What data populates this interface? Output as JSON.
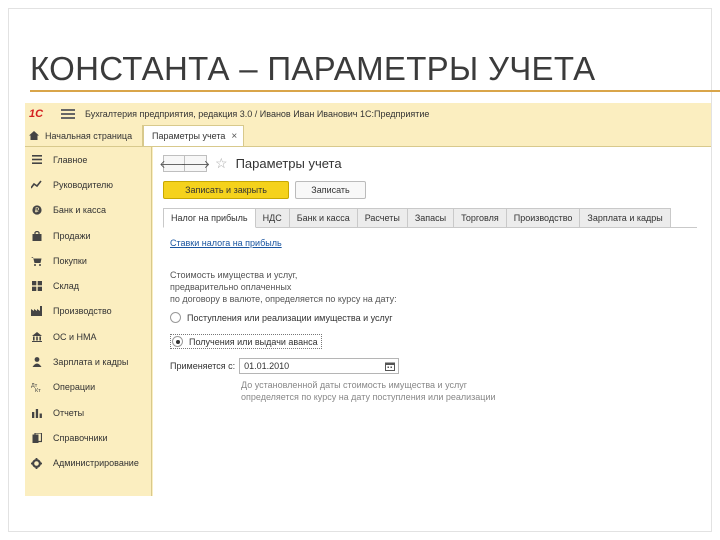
{
  "slide": {
    "title": "КОНСТАНТА – ПАРАМЕТРЫ УЧЕТА"
  },
  "app": {
    "logo": "1С",
    "title": "Бухгалтерия предприятия, редакция 3.0 / Иванов Иван Иванович 1С:Предприятие",
    "accent_color": "#f5d21c",
    "panel_color": "#fbeec0"
  },
  "tabs": {
    "home_label": "Начальная страница",
    "active_label": "Параметры учета",
    "close_glyph": "×"
  },
  "sidebar": {
    "items": [
      {
        "label": "Главное",
        "icon": "list-icon"
      },
      {
        "label": "Руководителю",
        "icon": "chart-icon"
      },
      {
        "label": "Банк и касса",
        "icon": "coin-icon"
      },
      {
        "label": "Продажи",
        "icon": "bag-icon"
      },
      {
        "label": "Покупки",
        "icon": "cart-icon"
      },
      {
        "label": "Склад",
        "icon": "grid-icon"
      },
      {
        "label": "Производство",
        "icon": "factory-icon"
      },
      {
        "label": "ОС и НМА",
        "icon": "building-icon"
      },
      {
        "label": "Зарплата и кадры",
        "icon": "people-icon"
      },
      {
        "label": "Операции",
        "icon": "operations-icon"
      },
      {
        "label": "Отчеты",
        "icon": "bar-chart-icon"
      },
      {
        "label": "Справочники",
        "icon": "book-icon"
      },
      {
        "label": "Администрирование",
        "icon": "gear-icon"
      }
    ]
  },
  "form": {
    "title": "Параметры учета",
    "back_glyph": "🡐",
    "forward_glyph": "🡒",
    "star_glyph": "☆",
    "save_close_label": "Записать и закрыть",
    "save_label": "Записать",
    "tabs": [
      "Налог на прибыль",
      "НДС",
      "Банк и касса",
      "Расчеты",
      "Запасы",
      "Торговля",
      "Производство",
      "Зарплата и кадры"
    ],
    "active_tab_index": 0,
    "rate_link": "Ставки налога на прибыль",
    "description_lines": [
      "Стоимость имущества и услуг,",
      "предварительно оплаченных",
      "по договору в валюте, определяется по курсу на дату:"
    ],
    "radio_options": [
      {
        "label": "Поступления или реализации имущества и услуг",
        "checked": false
      },
      {
        "label": "Получения или выдачи аванса",
        "checked": true
      }
    ],
    "applies_from_label": "Применяется с:",
    "applies_from_value": "01.01.2010",
    "hint_lines": [
      "До установленной даты стоимость имущества и услуг",
      "определяется по курсу на дату поступления или реализации"
    ]
  }
}
